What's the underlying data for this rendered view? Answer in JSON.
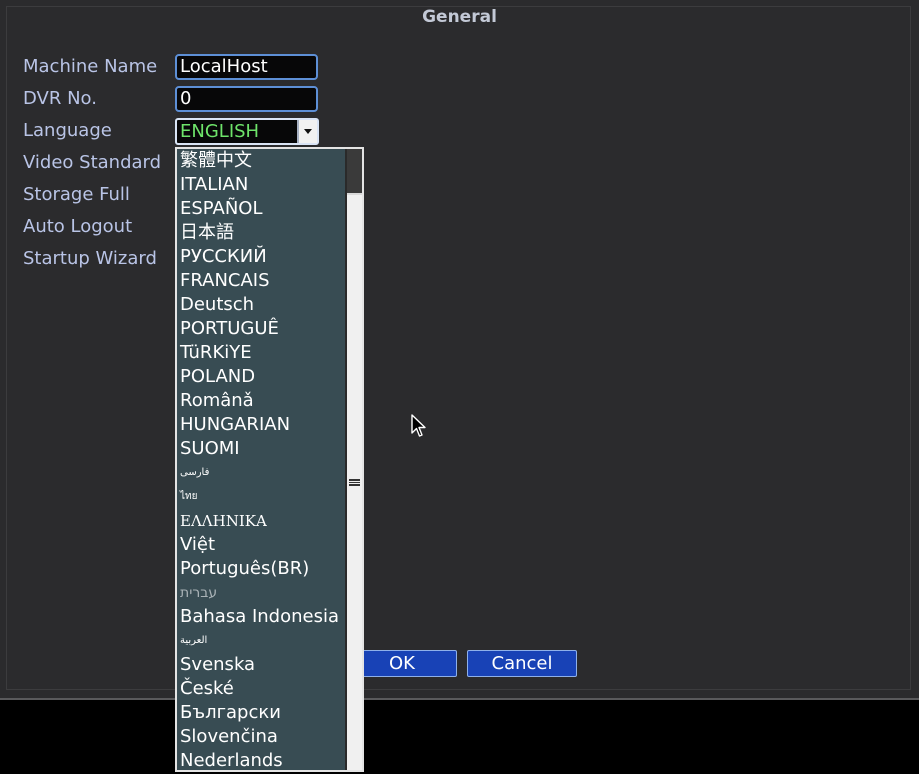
{
  "dialog": {
    "title": "General"
  },
  "fields": {
    "machine_name": {
      "label": "Machine Name",
      "value": "LocalHost"
    },
    "dvr_no": {
      "label": "DVR No.",
      "value": "0"
    },
    "language": {
      "label": "Language",
      "value": "ENGLISH"
    },
    "video_standard": {
      "label": "Video Standard"
    },
    "storage_full": {
      "label": "Storage Full"
    },
    "auto_logout": {
      "label": "Auto Logout"
    },
    "startup_wizard": {
      "label": "Startup Wizard"
    }
  },
  "language_options": [
    "繁體中文",
    "ITALIAN",
    "ESPAÑOL",
    "日本語",
    "РУССКИЙ",
    "FRANCAIS",
    "Deutsch",
    "PORTUGUÊ",
    "TüRKiYE",
    "POLAND",
    "Românǎ",
    "HUNGARIAN",
    "SUOMI",
    "فارسی",
    "ไทย",
    "ΕΛΛΗΝΙΚΑ",
    "Việt",
    "Português(BR)",
    "עברית",
    "Bahasa Indonesia",
    "العربية",
    "Svenska",
    "České",
    "Български",
    "Slovenčina",
    "Nederlands"
  ],
  "buttons": {
    "ok": "OK",
    "cancel": "Cancel"
  },
  "colors": {
    "dialog_bg": "#2b2b2d",
    "label_text": "#b9c4e6",
    "selected_language": "#6ee36a",
    "dropdown_bg": "#384c53",
    "button_bg": "#1842b6"
  }
}
